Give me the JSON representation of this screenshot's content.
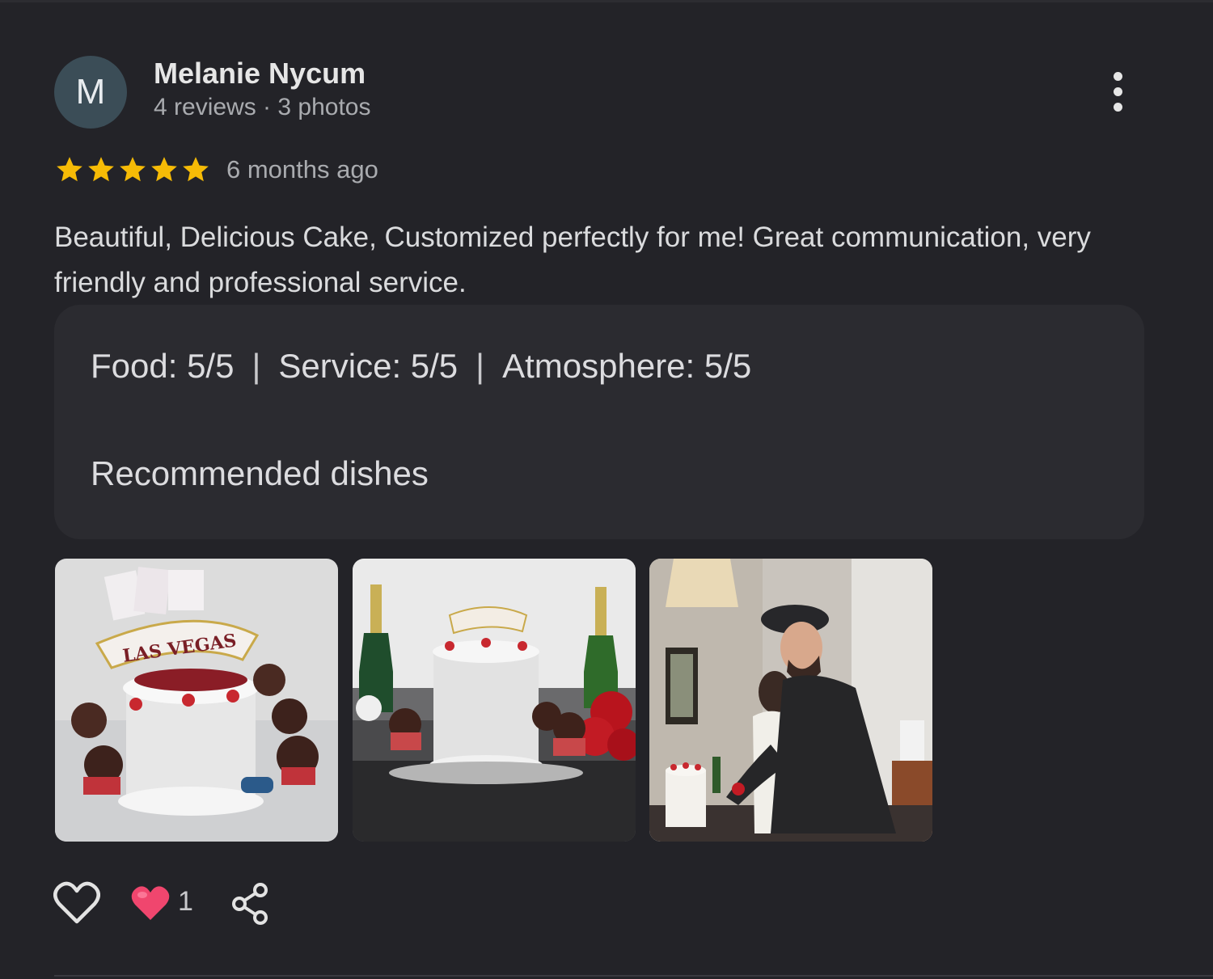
{
  "review": {
    "author": {
      "initial": "M",
      "name": "Melanie Nycum",
      "meta": "4 reviews · 3 photos"
    },
    "rating_stars": 5,
    "date": "6 months ago",
    "text": "Beautiful, Delicious Cake, Customized perfectly for me! Great communication, very friendly and professional service.",
    "ratings": {
      "food": "Food: 5/5",
      "service": "Service: 5/5",
      "atmosphere": "Atmosphere: 5/5",
      "separator": "|"
    },
    "recommended_label": "Recommended dishes",
    "photos": [
      {
        "name": "photo-cake-with-cupcakes"
      },
      {
        "name": "photo-cake-with-champagne"
      },
      {
        "name": "photo-couple-cutting-cake"
      }
    ],
    "photo_sign_text": "LAS VEGAS",
    "reactions": {
      "like_icon": "heart-outline-icon",
      "reaction_icon": "heart-filled-icon",
      "count": "1",
      "share_icon": "share-icon"
    }
  },
  "colors": {
    "background": "#232328",
    "card": "#2b2b30",
    "star": "#f6bb06",
    "avatar": "#3b4d57",
    "reaction_heart": "#f0466e"
  }
}
